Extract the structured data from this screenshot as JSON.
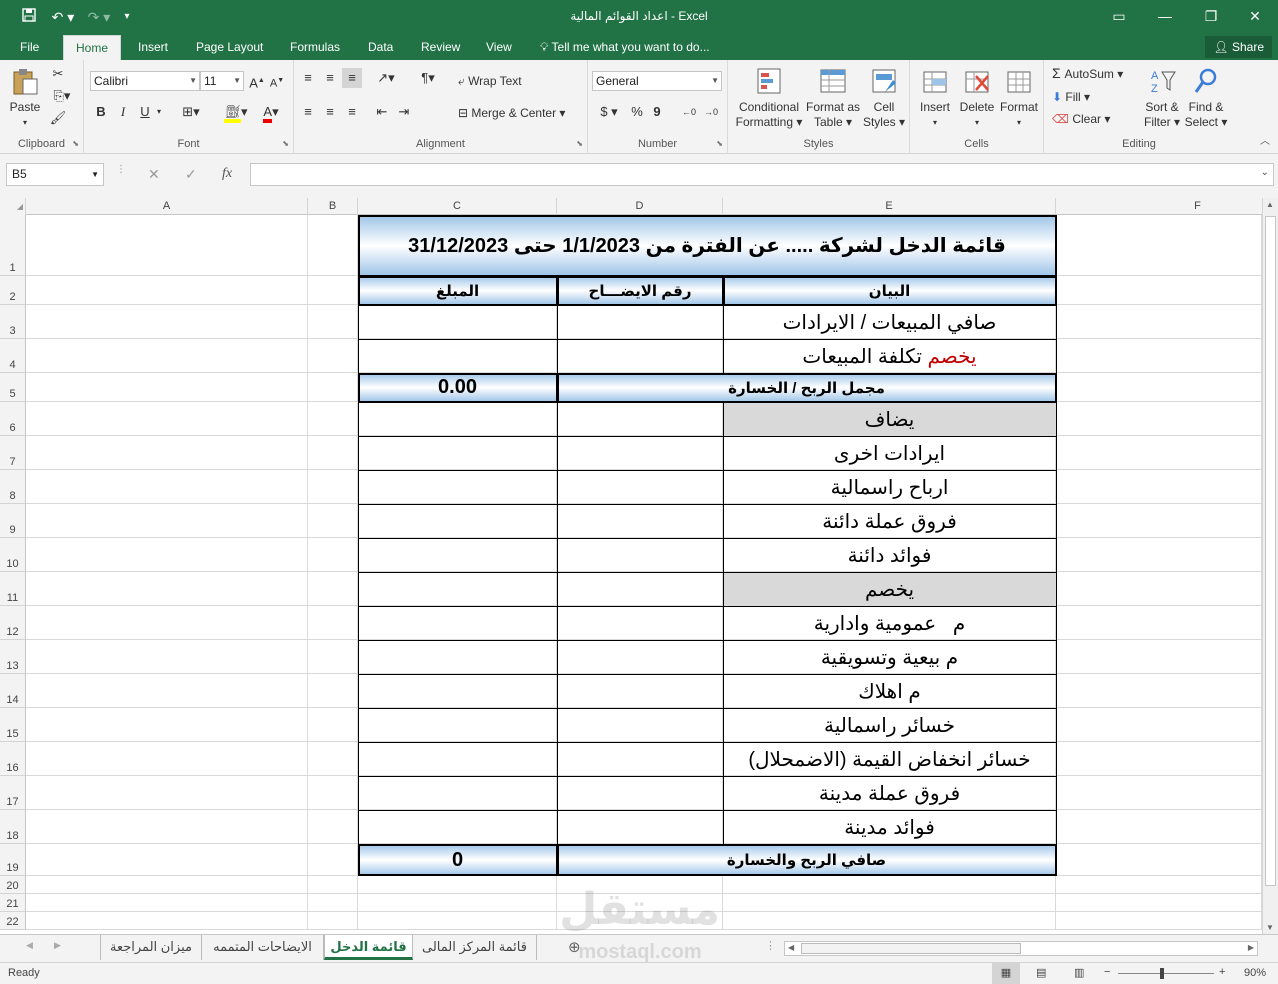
{
  "titlebar": {
    "title": "اعداد القوائم المالية - Excel",
    "undo_icon": "undo-icon",
    "redo_icon": "redo-icon"
  },
  "ribbon_tabs": [
    "File",
    "Home",
    "Insert",
    "Page Layout",
    "Formulas",
    "Data",
    "Review",
    "View"
  ],
  "active_tab": "Home",
  "tell_me": "Tell me what you want to do...",
  "share": "Share",
  "clipboard": {
    "label": "Clipboard",
    "paste": "Paste"
  },
  "font": {
    "label": "Font",
    "name": "Calibri",
    "size": "11",
    "bold": "B",
    "italic": "I",
    "underline": "U"
  },
  "alignment": {
    "label": "Alignment",
    "wrap": "Wrap Text",
    "merge": "Merge & Center"
  },
  "number": {
    "label": "Number",
    "format": "General",
    "currency": "$",
    "percent": "%",
    "comma": "9"
  },
  "styles": {
    "label": "Styles",
    "conditional": "Conditional",
    "formatting": "Formatting",
    "format_as": "Format as",
    "table": "Table",
    "cell": "Cell",
    "cell_styles": "Styles"
  },
  "cells": {
    "label": "Cells",
    "insert": "Insert",
    "delete": "Delete",
    "format": "Format"
  },
  "editing": {
    "label": "Editing",
    "autosum": "AutoSum",
    "fill": "Fill",
    "clear": "Clear",
    "sort": "Sort &",
    "filter": "Filter",
    "find": "Find &",
    "select": "Select"
  },
  "formula_bar": {
    "name_box": "B5",
    "formula": ""
  },
  "columns": [
    "A",
    "B",
    "C",
    "D",
    "E",
    "F"
  ],
  "rows": [
    "1",
    "2",
    "3",
    "4",
    "5",
    "6",
    "7",
    "8",
    "9",
    "10",
    "11",
    "12",
    "13",
    "14",
    "15",
    "16",
    "17",
    "18",
    "19",
    "20",
    "21",
    "22"
  ],
  "sheet": {
    "title": "قائمة الدخل لشركة   .....  عن الفترة من 1/1/2023 حتى 31/12/2023",
    "hdr_desc": "البيان",
    "hdr_note": "رقم الايضـــاح",
    "hdr_amount": "المبلغ",
    "r3": "صافي المبيعات / الايرادات",
    "r4_red": "يخصم",
    "r4": " تكلفة المبيعات",
    "r5_label": "مجمل الربح / الخسارة",
    "r5_value": "0.00",
    "r6": "يضاف",
    "r7": "ايرادات اخرى",
    "r8": "ارباح راسمالية",
    "r9": "فروق عملة دائنة",
    "r10": "فوائد دائنة",
    "r11": "يخصم",
    "r12": "م   عمومية وادارية",
    "r13": "م بيعية وتسويقية",
    "r14": "م اهلاك",
    "r15": "خسائر راسمالية",
    "r16": "خسائر انخفاض القيمة (الاضمحلال)",
    "r17": "فروق عملة مدينة",
    "r18": "فوائد مدينة",
    "r19_label": "صافي الربح والخسارة",
    "r19_value": "0"
  },
  "sheet_tabs": [
    "ميزان المراجعة",
    "الايضاحات المتممه",
    "قائمة الدخل",
    "قائمة المركز المالى"
  ],
  "active_sheet": "قائمة الدخل",
  "watermark": {
    "line1": "مستقل",
    "line2": "mostaql.com"
  },
  "status": {
    "ready": "Ready",
    "zoom": "90%"
  },
  "colors": {
    "excel_green": "#217346",
    "header_blue": "#9cc3e8",
    "red_text": "#c00000"
  }
}
